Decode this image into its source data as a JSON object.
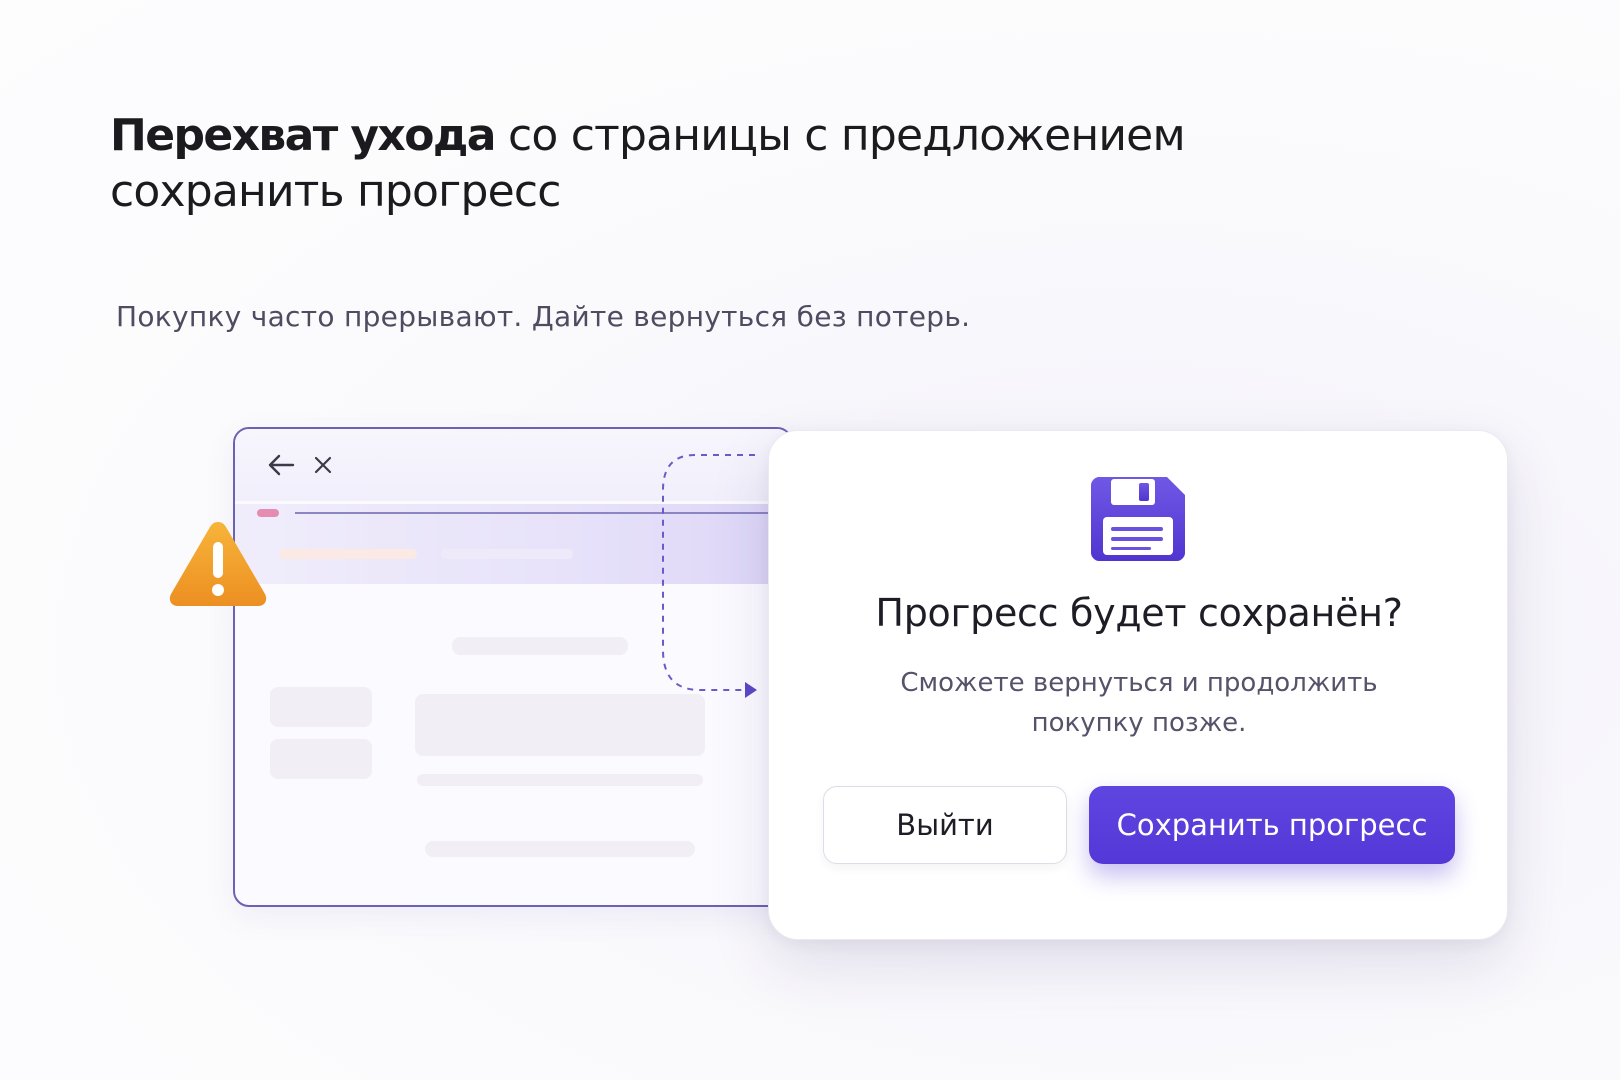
{
  "headline": {
    "bold": "Перехват ухода",
    "rest_line1": " со страницы с предложением",
    "rest_line2": "сохранить прогресс"
  },
  "subtitle": "Покупку часто прерывают. Дайте вернуться без потерь.",
  "browser": {
    "back_icon": "arrow-left-icon",
    "close_icon": "close-icon"
  },
  "warning_icon": "warning-triangle-icon",
  "dialog": {
    "icon": "floppy-disk-icon",
    "title": "Прогресс будет сохранён?",
    "text": "Сможете вернуться и продолжить покупку позже.",
    "exit_label": "Выйти",
    "save_label": "Сохранить прогресс"
  },
  "colors": {
    "accent": "#5438d8",
    "warning": "#f0a030",
    "browser_border": "#6b62b4"
  }
}
